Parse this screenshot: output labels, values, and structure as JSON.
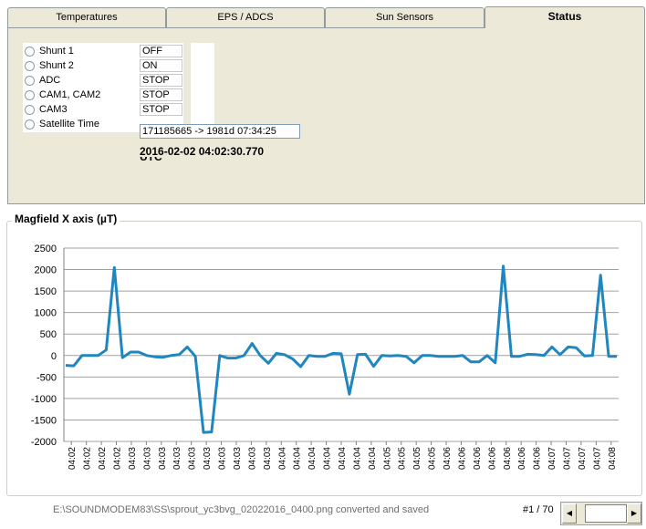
{
  "tabs": [
    {
      "label": "Temperatures",
      "active": false
    },
    {
      "label": "EPS / ADCS",
      "active": false
    },
    {
      "label": "Sun Sensors",
      "active": false
    },
    {
      "label": "Status",
      "active": true
    }
  ],
  "status": {
    "rows": [
      {
        "label": "Shunt 1",
        "value": "OFF"
      },
      {
        "label": "Shunt 2",
        "value": "ON"
      },
      {
        "label": "ADC",
        "value": "STOP"
      },
      {
        "label": "CAM1, CAM2",
        "value": "STOP"
      },
      {
        "label": "CAM3",
        "value": "STOP"
      },
      {
        "label": "Satellite Time",
        "value": "171185665 -> 1981d 07:34:25"
      }
    ],
    "datetime": "2016-02-02 04:02:30.770",
    "datetime_cut": "UTC"
  },
  "group_title": "Magfield X axis (µT)",
  "chart_data": {
    "type": "line",
    "title": "",
    "xlabel": "",
    "ylabel": "",
    "ylim": [
      -2000,
      2500
    ],
    "yticks": [
      2500,
      2000,
      1500,
      1000,
      500,
      0,
      -500,
      -1000,
      -1500,
      -2000
    ],
    "grid": true,
    "color": "#1f86c0",
    "x": [
      "04:02",
      "04:02",
      "04:02",
      "04:02",
      "04:02",
      "04:02",
      "04:03",
      "04:03",
      "04:03",
      "04:03",
      "04:03",
      "04:03",
      "04:03",
      "04:03",
      "04:03",
      "04:03",
      "04:03",
      "04:03",
      "04:03",
      "04:03",
      "04:04",
      "04:04",
      "04:04",
      "04:04",
      "04:04",
      "04:04",
      "04:04",
      "04:04",
      "04:04",
      "04:04",
      "04:04",
      "04:04",
      "04:04",
      "04:05",
      "04:05",
      "04:05",
      "04:05",
      "04:05",
      "04:05",
      "04:05",
      "04:06",
      "04:06",
      "04:06",
      "04:06",
      "04:06",
      "04:06",
      "04:06",
      "04:06",
      "04:06",
      "04:06",
      "04:06",
      "04:06",
      "04:06",
      "04:07",
      "04:07",
      "04:07",
      "04:07",
      "04:07",
      "04:07",
      "04:07",
      "04:07",
      "04:07",
      "04:07",
      "04:08",
      "04:08"
    ],
    "xticks": [
      "04:02",
      "04:02",
      "04:02",
      "04:02",
      "04:03",
      "04:03",
      "04:03",
      "04:03",
      "04:03",
      "04:03",
      "04:03",
      "04:03",
      "04:03",
      "04:03",
      "04:04",
      "04:04",
      "04:04",
      "04:04",
      "04:04",
      "04:04",
      "04:04",
      "04:05",
      "04:05",
      "04:05",
      "04:05",
      "04:06",
      "04:06",
      "04:06",
      "04:06",
      "04:06",
      "04:06",
      "04:06",
      "04:07",
      "04:07",
      "04:07",
      "04:07",
      "04:08"
    ],
    "values": [
      -230,
      -240,
      0,
      0,
      0,
      130,
      2050,
      -50,
      80,
      80,
      0,
      -30,
      -40,
      0,
      20,
      200,
      -20,
      -1790,
      -1780,
      0,
      -60,
      -60,
      0,
      280,
      0,
      -180,
      50,
      20,
      -80,
      -260,
      0,
      -20,
      -20,
      50,
      40,
      -900,
      20,
      30,
      -250,
      0,
      -10,
      0,
      -20,
      -170,
      0,
      0,
      -20,
      -20,
      -20,
      0,
      -150,
      -150,
      0,
      -170,
      2080,
      -20,
      -20,
      30,
      20,
      0,
      200,
      20,
      200,
      180,
      -10,
      0,
      1870,
      -20,
      -20
    ]
  },
  "footer": {
    "status": "E:\\SOUNDMODEM83\\SS\\sprout_yc3bvg_02022016_0400.png converted and saved",
    "page": "#1 / 70"
  },
  "icons": {
    "scroll_left": "arrow-left-icon",
    "scroll_right": "arrow-right-icon"
  }
}
